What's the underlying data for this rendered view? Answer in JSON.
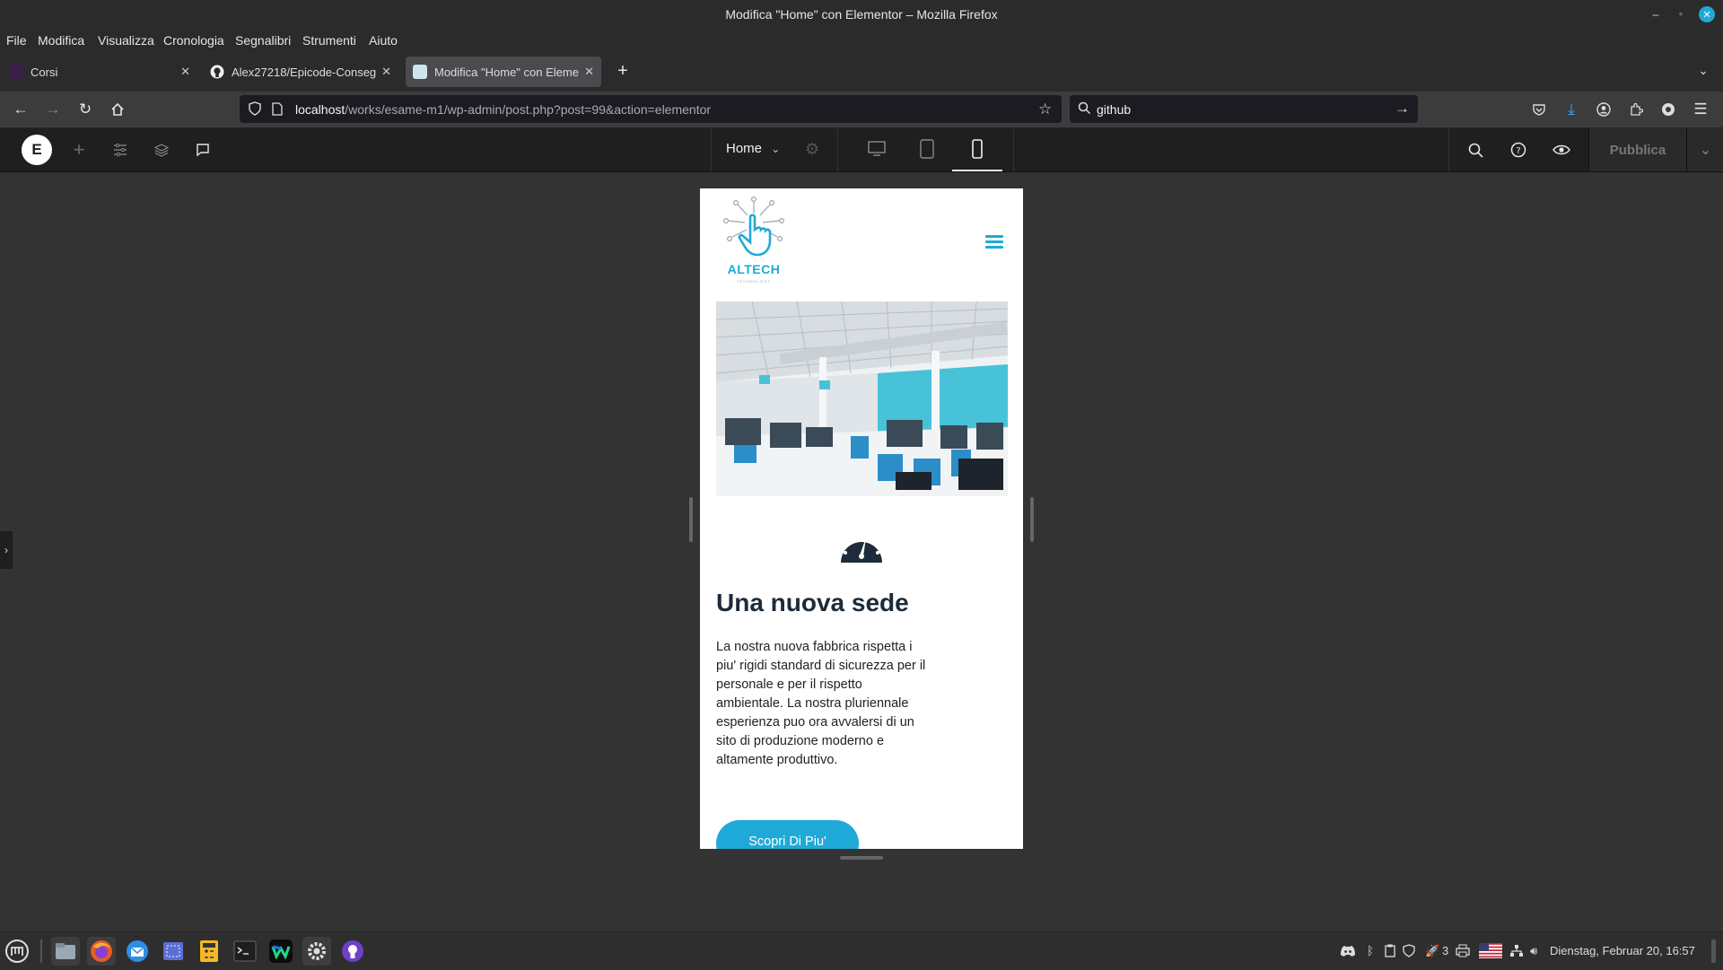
{
  "window": {
    "title": "Modifica \"Home\" con Elementor – Mozilla Firefox"
  },
  "menubar": [
    "File",
    "Modifica",
    "Visualizza",
    "Cronologia",
    "Segnalibri",
    "Strumenti",
    "Aiuto"
  ],
  "tabs": [
    {
      "label": "Corsi",
      "active": false
    },
    {
      "label": "Alex27218/Epicode-Conseg",
      "active": false
    },
    {
      "label": "Modifica \"Home\" con Eleme",
      "active": true
    }
  ],
  "address": {
    "host": "localhost",
    "path": "/works/esame-m1/wp-admin/post.php?post=99&action=elementor"
  },
  "search": {
    "query": "github"
  },
  "elementor": {
    "logo_letter": "E",
    "page_name": "Home",
    "publish_label": "Pubblica"
  },
  "site": {
    "logo_text": "ALTECH",
    "logo_tagline": "TECHNOLOGY",
    "heading": "Una nuova sede",
    "body_lines": [
      "La nostra nuova fabbrica rispetta i",
      "piu' rigidi standard di sicurezza per il",
      "personale e per il rispetto",
      "ambientale. La nostra pluriennale",
      "esperienza puo ora avvalersi di un",
      "sito di produzione moderno e",
      "altamente produttivo."
    ],
    "cta_label": "Scopri Di Piu'",
    "accent": "#1fa9d8",
    "heading_color": "#1d2b3a"
  },
  "taskbar": {
    "clock": "Dienstag, Februar 20, 16:57",
    "tray_badge": "3"
  }
}
